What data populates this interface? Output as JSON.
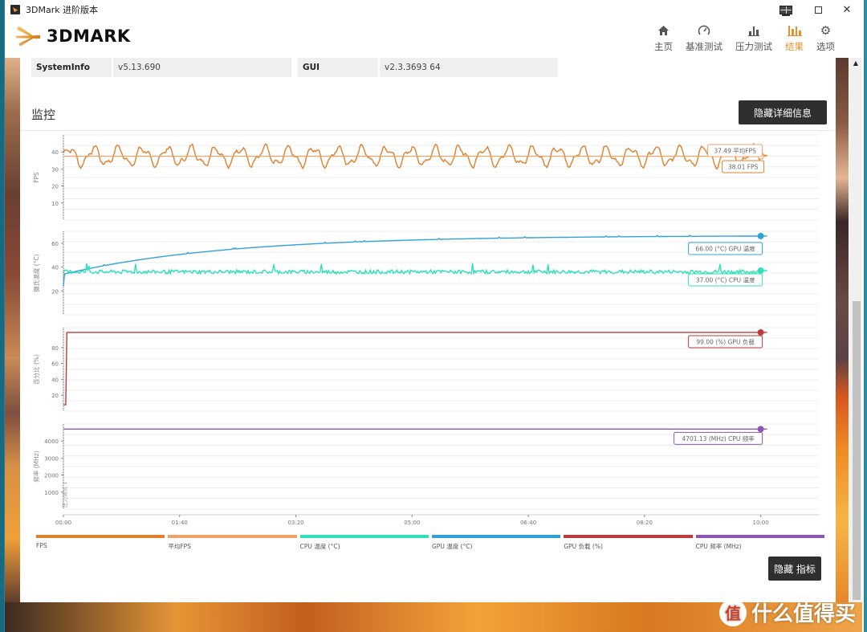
{
  "window": {
    "title": "3DMark 进阶版本",
    "controls": [
      "monitor-icon",
      "maximize-icon",
      "close-icon"
    ]
  },
  "header": {
    "logo_text": "3DMARK",
    "nav": [
      {
        "label": "主页",
        "icon": "home-icon",
        "active": false
      },
      {
        "label": "基准测试",
        "icon": "gauge-icon",
        "active": false
      },
      {
        "label": "压力测试",
        "icon": "bar-chart-icon",
        "active": false
      },
      {
        "label": "结果",
        "icon": "results-icon",
        "active": true
      },
      {
        "label": "选项",
        "icon": "gear-icon",
        "active": false
      }
    ],
    "accent_color": "#e8912c"
  },
  "info": {
    "rows": [
      {
        "key": "SystemInfo",
        "value": "v5.13.690"
      },
      {
        "key": "GUI",
        "value": "v2.3.3693 64"
      }
    ]
  },
  "monitor": {
    "title": "监控",
    "hide_details_button": "隐藏详细信息",
    "hide_metrics_button": "隐藏 指标"
  },
  "watermark": {
    "circle": "值",
    "text": "什么值得买"
  },
  "chart_data": [
    {
      "type": "line",
      "id": "fps",
      "ylabel": "FPS",
      "ylim": [
        0,
        50
      ],
      "yticks": [
        10,
        20,
        30,
        40
      ],
      "xlim": [
        0,
        600
      ],
      "series": [
        {
          "name": "FPS",
          "color": "#e07f2c",
          "pattern": "oscillating",
          "mean": 37.5,
          "amplitude": 6,
          "period_s": 21,
          "end_value": 38.01
        },
        {
          "name": "平均FPS",
          "color": "#eda26a",
          "pattern": "constant",
          "value": 37.49
        }
      ],
      "callouts": [
        {
          "text": "37.49 平均FPS",
          "color": "#eda26a"
        },
        {
          "text": "38.01 FPS",
          "color": "#e07f2c"
        }
      ]
    },
    {
      "type": "line",
      "id": "temperature",
      "ylabel": "摄氏温度 (°C)",
      "ylim": [
        0,
        70
      ],
      "yticks": [
        20,
        40,
        60
      ],
      "xlim": [
        0,
        600
      ],
      "series": [
        {
          "name": "GPU 温度 (°C)",
          "color": "#2fa3d6",
          "pattern": "rising",
          "start_value": 34,
          "end_value": 66
        },
        {
          "name": "CPU 温度 (°C)",
          "color": "#2ee0b8",
          "pattern": "noisy",
          "mean": 37,
          "amplitude": 2,
          "end_value": 37
        }
      ],
      "callouts": [
        {
          "text": "66.00 (°C) GPU 温度",
          "color": "#2fa3d6"
        },
        {
          "text": "37.00 (°C) CPU 温度",
          "color": "#2ee0b8"
        }
      ]
    },
    {
      "type": "line",
      "id": "load",
      "ylabel": "百分比 (%)",
      "ylim": [
        0,
        105
      ],
      "yticks": [
        20,
        40,
        60,
        80
      ],
      "xlim": [
        0,
        600
      ],
      "series": [
        {
          "name": "GPU 负载 (%)",
          "color": "#c0393b",
          "pattern": "step",
          "start_value": 8,
          "value": 99,
          "end_value": 99
        }
      ],
      "callouts": [
        {
          "text": "99.00 (%) GPU 负载",
          "color": "#c0393b"
        }
      ]
    },
    {
      "type": "line",
      "id": "frequency",
      "ylabel": "频率 (MHz)",
      "ylim": [
        0,
        5000
      ],
      "yticks": [
        1000,
        2000,
        3000,
        4000
      ],
      "xlim": [
        0,
        600
      ],
      "marker_label": "压力测试 1",
      "series": [
        {
          "name": "CPU 频率 (MHz)",
          "color": "#8c55b6",
          "pattern": "constant",
          "value": 4701.13,
          "end_value": 4701.13
        }
      ],
      "callouts": [
        {
          "text": "4701.13 (MHz) CPU 频率",
          "color": "#8c55b6"
        }
      ]
    }
  ],
  "x_axis": {
    "ticks": [
      "00:00",
      "01:40",
      "03:20",
      "05:00",
      "06:40",
      "08:20",
      "10:00"
    ],
    "tick_seconds": [
      0,
      100,
      200,
      300,
      400,
      500,
      600
    ],
    "range_seconds": [
      0,
      650
    ]
  },
  "legend": [
    {
      "label": "FPS",
      "color": "#e07f2c"
    },
    {
      "label": "平均FPS",
      "color": "#eda26a"
    },
    {
      "label": "CPU 温度 (°C)",
      "color": "#2ee0b8"
    },
    {
      "label": "GPU 温度 (°C)",
      "color": "#2fa3d6"
    },
    {
      "label": "GPU 负载 (%)",
      "color": "#c0393b"
    },
    {
      "label": "CPU 频率 (MHz)",
      "color": "#8c55b6"
    }
  ]
}
